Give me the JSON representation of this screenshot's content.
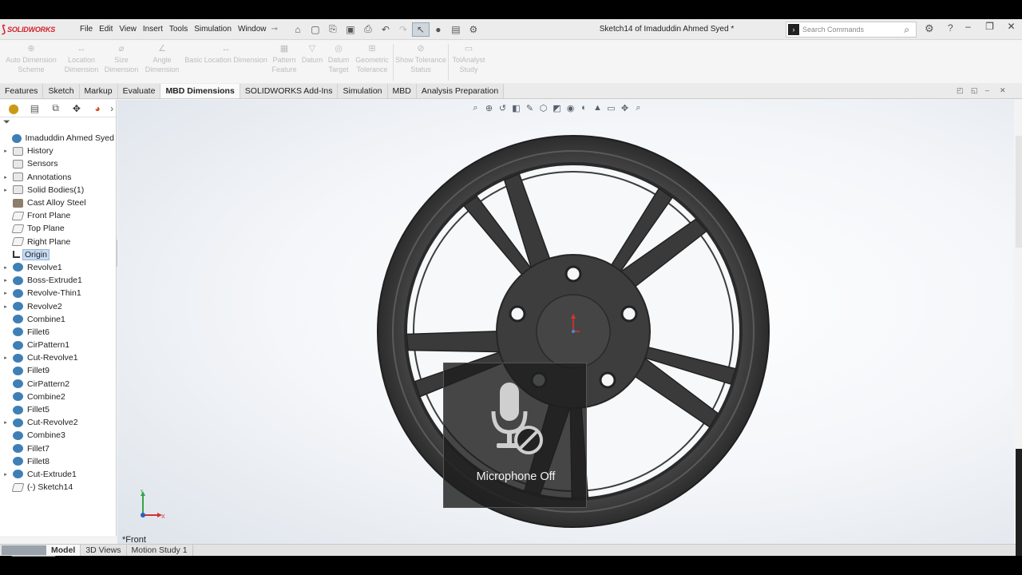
{
  "app": {
    "brand": "SOLIDWORKS",
    "menus": [
      "File",
      "Edit",
      "View",
      "Insert",
      "Tools",
      "Simulation",
      "Window"
    ],
    "document_title": "Sketch14 of Imaduddin Ahmed Syed *",
    "search_placeholder": "Search Commands"
  },
  "ribbon": [
    {
      "label": "Auto Dimension Scheme"
    },
    {
      "label": "Location Dimension"
    },
    {
      "label": "Size Dimension"
    },
    {
      "label": "Angle Dimension"
    },
    {
      "label": "Basic Location Dimension"
    },
    {
      "label": "Pattern Feature"
    },
    {
      "label": "Datum"
    },
    {
      "label": "Datum Target"
    },
    {
      "label": "Geometric Tolerance"
    },
    {
      "label": "Show Tolerance Status"
    },
    {
      "label": "TolAnalyst Study"
    }
  ],
  "tabs": [
    "Features",
    "Sketch",
    "Markup",
    "Evaluate",
    "MBD Dimensions",
    "SOLIDWORKS Add-Ins",
    "Simulation",
    "MBD",
    "Analysis Preparation"
  ],
  "active_tab": "MBD Dimensions",
  "tree": [
    {
      "label": "Imaduddin Ahmed Syed",
      "icon": "part-icon",
      "arrow": ""
    },
    {
      "label": "History",
      "icon": "folder-icon",
      "arrow": "▸"
    },
    {
      "label": "Sensors",
      "icon": "folder-icon",
      "arrow": ""
    },
    {
      "label": "Annotations",
      "icon": "folder-icon",
      "arrow": "▸"
    },
    {
      "label": "Solid Bodies(1)",
      "icon": "folder-icon",
      "arrow": "▸"
    },
    {
      "label": "Cast Alloy Steel",
      "icon": "material-icon",
      "arrow": ""
    },
    {
      "label": "Front Plane",
      "icon": "plane-icon",
      "arrow": ""
    },
    {
      "label": "Top Plane",
      "icon": "plane-icon",
      "arrow": ""
    },
    {
      "label": "Right Plane",
      "icon": "plane-icon",
      "arrow": ""
    },
    {
      "label": "Origin",
      "icon": "origin-icon",
      "arrow": "",
      "selected": true
    },
    {
      "label": "Revolve1",
      "icon": "feature-icon",
      "arrow": "▸"
    },
    {
      "label": "Boss-Extrude1",
      "icon": "feature-icon",
      "arrow": "▸"
    },
    {
      "label": "Revolve-Thin1",
      "icon": "feature-icon",
      "arrow": "▸"
    },
    {
      "label": "Revolve2",
      "icon": "feature-icon",
      "arrow": "▸"
    },
    {
      "label": "Combine1",
      "icon": "feature-icon",
      "arrow": ""
    },
    {
      "label": "Fillet6",
      "icon": "feature-icon",
      "arrow": ""
    },
    {
      "label": "CirPattern1",
      "icon": "feature-icon",
      "arrow": ""
    },
    {
      "label": "Cut-Revolve1",
      "icon": "feature-icon",
      "arrow": "▸"
    },
    {
      "label": "Fillet9",
      "icon": "feature-icon",
      "arrow": ""
    },
    {
      "label": "CirPattern2",
      "icon": "feature-icon",
      "arrow": ""
    },
    {
      "label": "Combine2",
      "icon": "feature-icon",
      "arrow": ""
    },
    {
      "label": "Fillet5",
      "icon": "feature-icon",
      "arrow": ""
    },
    {
      "label": "Cut-Revolve2",
      "icon": "feature-icon",
      "arrow": "▸"
    },
    {
      "label": "Combine3",
      "icon": "feature-icon",
      "arrow": ""
    },
    {
      "label": "Fillet7",
      "icon": "feature-icon",
      "arrow": ""
    },
    {
      "label": "Fillet8",
      "icon": "feature-icon",
      "arrow": ""
    },
    {
      "label": "Cut-Extrude1",
      "icon": "feature-icon",
      "arrow": "▸"
    },
    {
      "label": "(-) Sketch14",
      "icon": "sketch-icon",
      "arrow": ""
    }
  ],
  "viewport": {
    "view_name": "*Front",
    "triad": {
      "x": "X",
      "y": "Y"
    }
  },
  "bottom_tabs": [
    "Model",
    "3D Views",
    "Motion Study 1"
  ],
  "active_bottom_tab": "Model",
  "overlay": {
    "text": "Microphone Off",
    "icon": "microphone-off-icon"
  },
  "colors": {
    "brand": "#d6202a",
    "wheel": "#3a3a3a",
    "selection": "#c7dcf3"
  }
}
